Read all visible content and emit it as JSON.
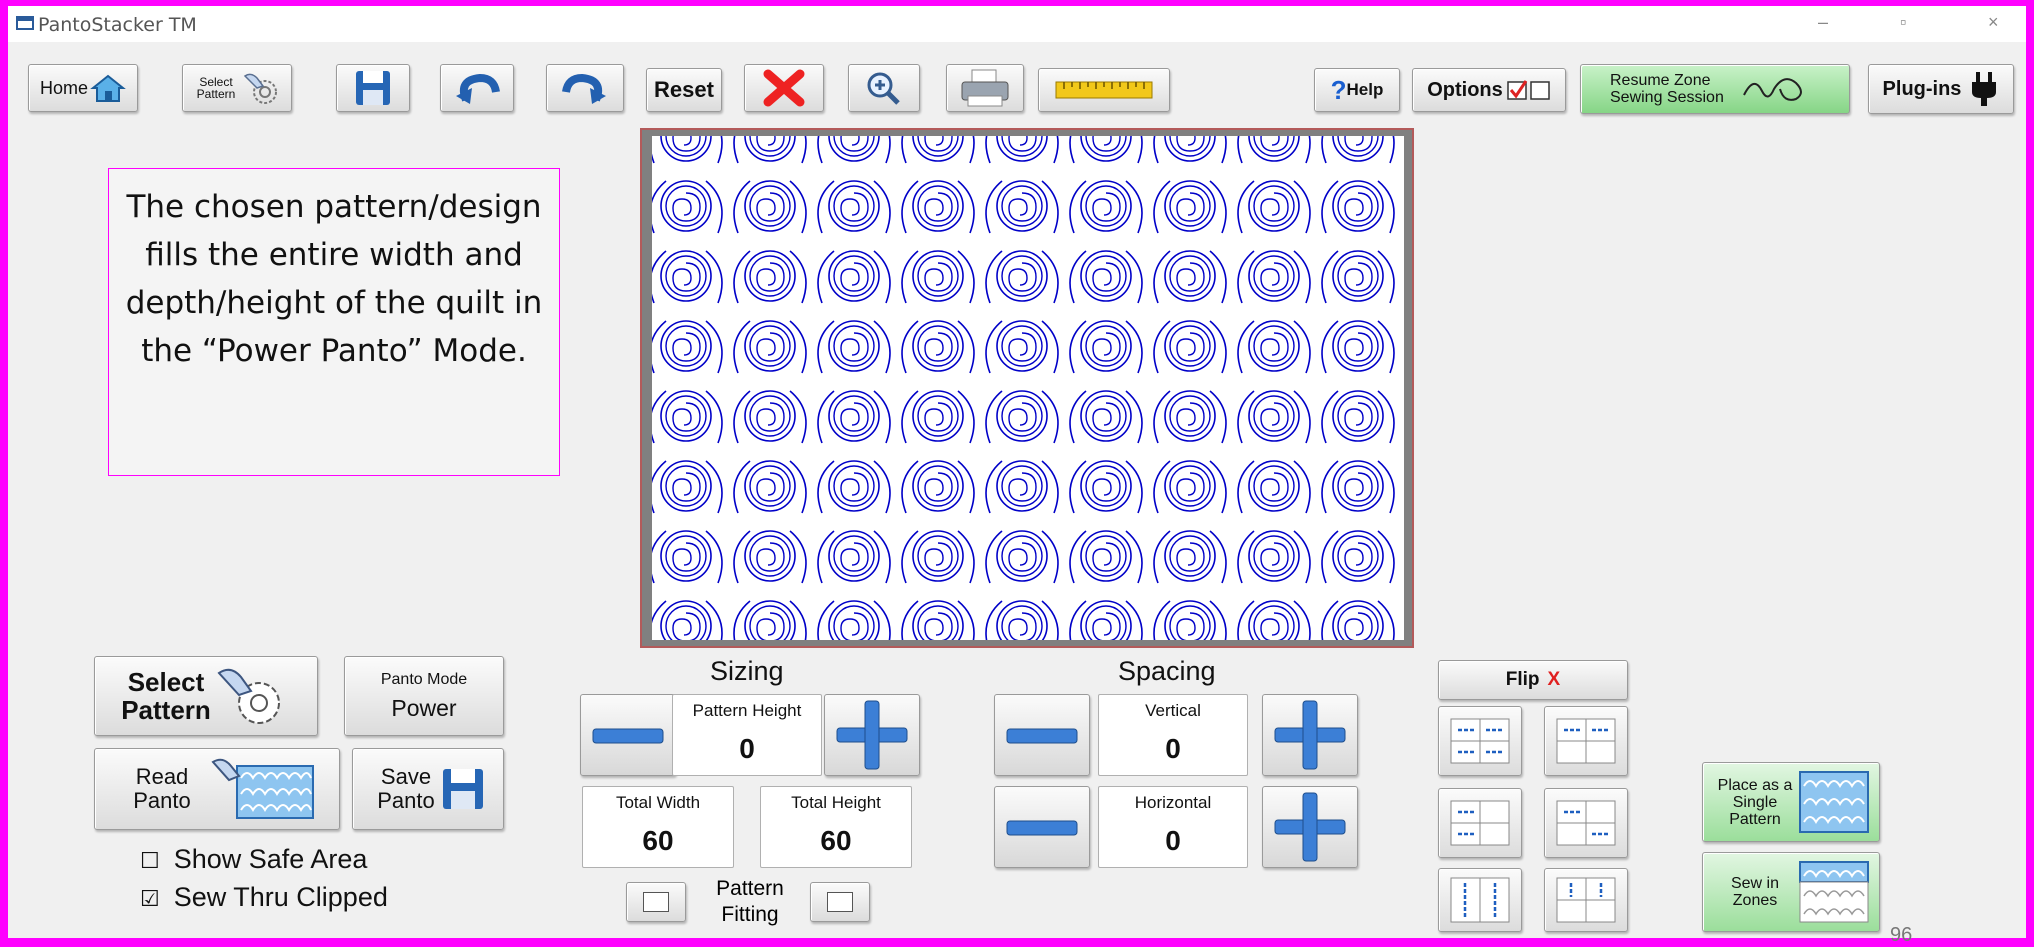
{
  "window": {
    "title": "PantoStacker TM",
    "minimize": "–",
    "restore": "▫",
    "close": "×"
  },
  "toolbar": {
    "home": "Home",
    "select_pattern": "Select Pattern",
    "reset": "Reset",
    "help": "Help",
    "options": "Options",
    "resume": "Resume Zone Sewing Session",
    "plugins": "Plug-ins"
  },
  "note": "The chosen pattern/design fills the entire width and depth/height of the quilt in the “Power Panto” Mode.",
  "left": {
    "select_pattern": "Select Pattern",
    "panto_mode_label": "Panto Mode",
    "panto_mode_value": "Power",
    "read_panto": "Read Panto",
    "save_panto": "Save Panto",
    "show_safe_area": "Show Safe Area",
    "sew_thru_clipped": "Sew Thru Clipped"
  },
  "sizing": {
    "title": "Sizing",
    "pattern_height_label": "Pattern Height",
    "pattern_height": "0",
    "total_width_label": "Total Width",
    "total_width": "60",
    "total_height_label": "Total Height",
    "total_height": "60",
    "pattern_fitting": "Pattern Fitting"
  },
  "spacing": {
    "title": "Spacing",
    "vertical_label": "Vertical",
    "vertical": "0",
    "horizontal_label": "Horizontal",
    "horizontal": "0"
  },
  "flip": {
    "label": "Flip",
    "mark": "X"
  },
  "right": {
    "place_single": "Place as a Single Pattern",
    "sew_zones": "Sew in Zones"
  },
  "page_number": "96",
  "colors": {
    "border": "#ff00ff",
    "pattern": "#0000c8",
    "plus": "#3c7fd6"
  }
}
